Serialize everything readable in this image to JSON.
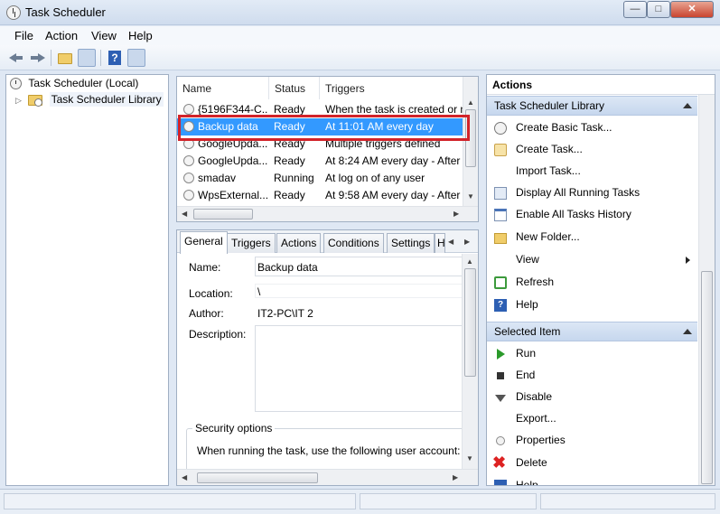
{
  "window": {
    "title": "Task Scheduler"
  },
  "menu": [
    "File",
    "Action",
    "View",
    "Help"
  ],
  "tree": {
    "root": "Task Scheduler (Local)",
    "library": "Task Scheduler Library"
  },
  "task_list": {
    "columns": [
      "Name",
      "Status",
      "Triggers"
    ],
    "rows": [
      {
        "name": "{5196F344-C...",
        "status": "Ready",
        "trigger": "When the task is created or m"
      },
      {
        "name": "Backup data",
        "status": "Ready",
        "trigger": "At 11:01 AM every day"
      },
      {
        "name": "GoogleUpda...",
        "status": "Ready",
        "trigger": "Multiple triggers defined"
      },
      {
        "name": "GoogleUpda...",
        "status": "Ready",
        "trigger": "At 8:24 AM every day - After"
      },
      {
        "name": "smadav",
        "status": "Running",
        "trigger": "At log on of any user"
      },
      {
        "name": "WpsExternal...",
        "status": "Ready",
        "trigger": "At 9:58 AM every day - After"
      }
    ]
  },
  "detail": {
    "tabs": [
      "General",
      "Triggers",
      "Actions",
      "Conditions",
      "Settings",
      "H"
    ],
    "name_label": "Name:",
    "name_value": "Backup data",
    "location_label": "Location:",
    "location_value": "\\",
    "author_label": "Author:",
    "author_value": "IT2-PC\\IT 2",
    "description_label": "Description:",
    "security_title": "Security options",
    "security_text": "When running the task, use the following user account:"
  },
  "actions_pane": {
    "header": "Actions",
    "section1": "Task Scheduler Library",
    "section1_items": [
      "Create Basic Task...",
      "Create Task...",
      "Import Task...",
      "Display All Running Tasks",
      "Enable All Tasks History",
      "New Folder...",
      "View",
      "Refresh",
      "Help"
    ],
    "section2": "Selected Item",
    "section2_items": [
      "Run",
      "End",
      "Disable",
      "Export...",
      "Properties",
      "Delete",
      "Help"
    ]
  },
  "colors": {
    "selection": "#3399ff",
    "highlight_border": "#d2232a",
    "section_bg": "#c6d7ee"
  }
}
